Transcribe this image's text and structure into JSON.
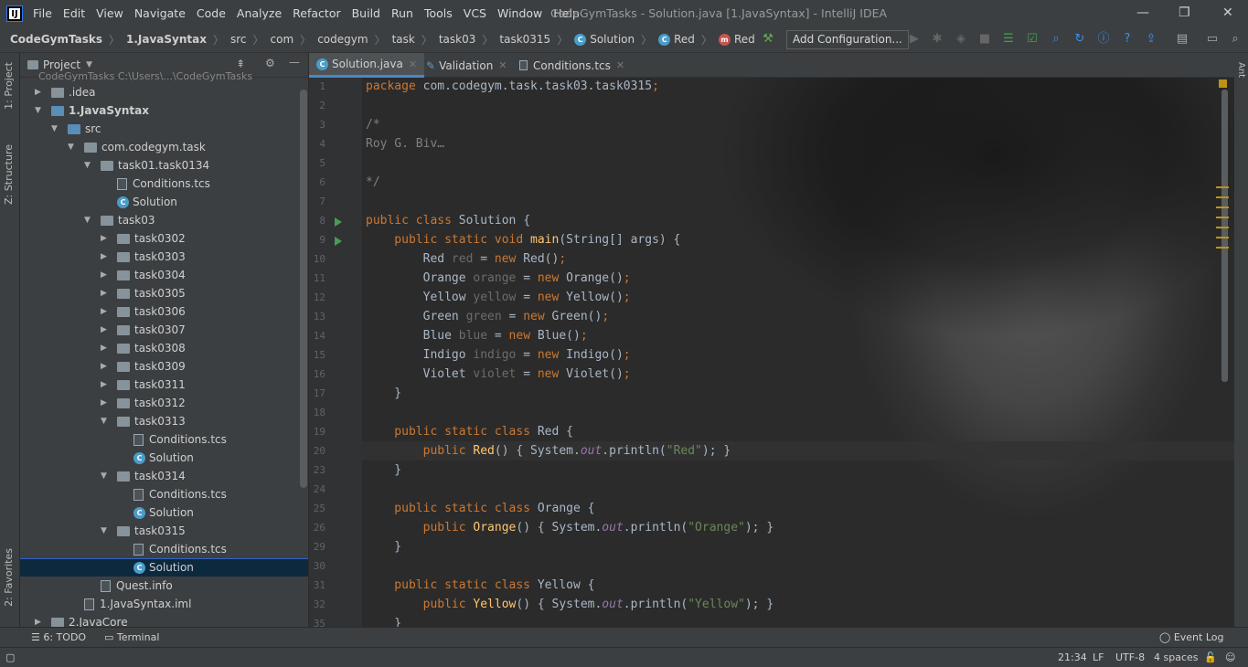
{
  "menubar": {
    "items": [
      "File",
      "Edit",
      "View",
      "Navigate",
      "Code",
      "Analyze",
      "Refactor",
      "Build",
      "Run",
      "Tools",
      "VCS",
      "Window",
      "Help"
    ],
    "window_title": "CodeGymTasks - Solution.java [1.JavaSyntax] - IntelliJ IDEA",
    "logo_text": "IJ"
  },
  "navbar": {
    "crumbs": [
      "CodeGymTasks",
      "1.JavaSyntax",
      "src",
      "com",
      "codegym",
      "task",
      "task03",
      "task0315",
      "Solution",
      "Red",
      "Red"
    ],
    "add_configuration": "Add Configuration..."
  },
  "left_strip": {
    "project": "1: Project",
    "structure": "Z: Structure",
    "favorites": "2: Favorites"
  },
  "right_strip": {
    "ant": "Ant"
  },
  "project_panel": {
    "title": "Project",
    "top_partial": "CodeGymTasks  C:\\Users\\...\\CodeGymTasks",
    "rows": [
      ".idea",
      "1.JavaSyntax",
      "src",
      "com.codegym.task",
      "task01.task0134",
      "Conditions.tcs",
      "Solution",
      "task03",
      "task0302",
      "task0303",
      "task0304",
      "task0305",
      "task0306",
      "task0307",
      "task0308",
      "task0309",
      "task0311",
      "task0312",
      "task0313",
      "Conditions.tcs",
      "Solution",
      "task0314",
      "Conditions.tcs",
      "Solution",
      "task0315",
      "Conditions.tcs",
      "Solution",
      "Quest.info",
      "1.JavaSyntax.iml",
      "2.JavaCore"
    ]
  },
  "editor": {
    "tabs": [
      "Solution.java",
      "Validation",
      "Conditions.tcs"
    ],
    "line_numbers": [
      "1",
      "2",
      "3",
      "4",
      "5",
      "6",
      "7",
      "8",
      "9",
      "10",
      "11",
      "12",
      "13",
      "14",
      "15",
      "16",
      "17",
      "18",
      "19",
      "20",
      "23",
      "24",
      "25",
      "26",
      "29",
      "30",
      "31",
      "32",
      "35"
    ],
    "code": {
      "l1a": "package ",
      "l1b": "com.codegym.task.task03.task0315",
      "l1c": ";",
      "l3": "/*",
      "l4": "Roy G. Biv…",
      "l6": "*/",
      "l8a": "public class ",
      "l8b": "Solution {",
      "l9a": "    public static void ",
      "l9b": "main",
      "l9c": "(String[] args) {",
      "decls": [
        {
          "type": "Red",
          "var": "red",
          "cls": "Red"
        },
        {
          "type": "Orange",
          "var": "orange",
          "cls": "Orange"
        },
        {
          "type": "Yellow",
          "var": "yellow",
          "cls": "Yellow"
        },
        {
          "type": "Green",
          "var": "green",
          "cls": "Green"
        },
        {
          "type": "Blue",
          "var": "blue",
          "cls": "Blue"
        },
        {
          "type": "Indigo",
          "var": "indigo",
          "cls": "Indigo"
        },
        {
          "type": "Violet",
          "var": "violet",
          "cls": "Violet"
        }
      ],
      "close_method": "    }",
      "classes": [
        {
          "name": "Red",
          "str": "\"Red\""
        },
        {
          "name": "Orange",
          "str": "\"Orange\""
        },
        {
          "name": "Yellow",
          "str": "\"Yellow\""
        }
      ],
      "psc": "    public static class ",
      "pub": "        public ",
      "ctor_a": "() { System.",
      "out": "out",
      "println": ".println(",
      "ctor_end": "); }",
      "brace_open": " {",
      "brace_close": "    }",
      "last": "    }"
    }
  },
  "bottombar": {
    "todo": "6: TODO",
    "terminal": "Terminal",
    "event_log": "Event Log"
  },
  "statusbar": {
    "position": "21:34",
    "line_sep": "LF",
    "encoding": "UTF-8",
    "indent": "4 spaces"
  }
}
